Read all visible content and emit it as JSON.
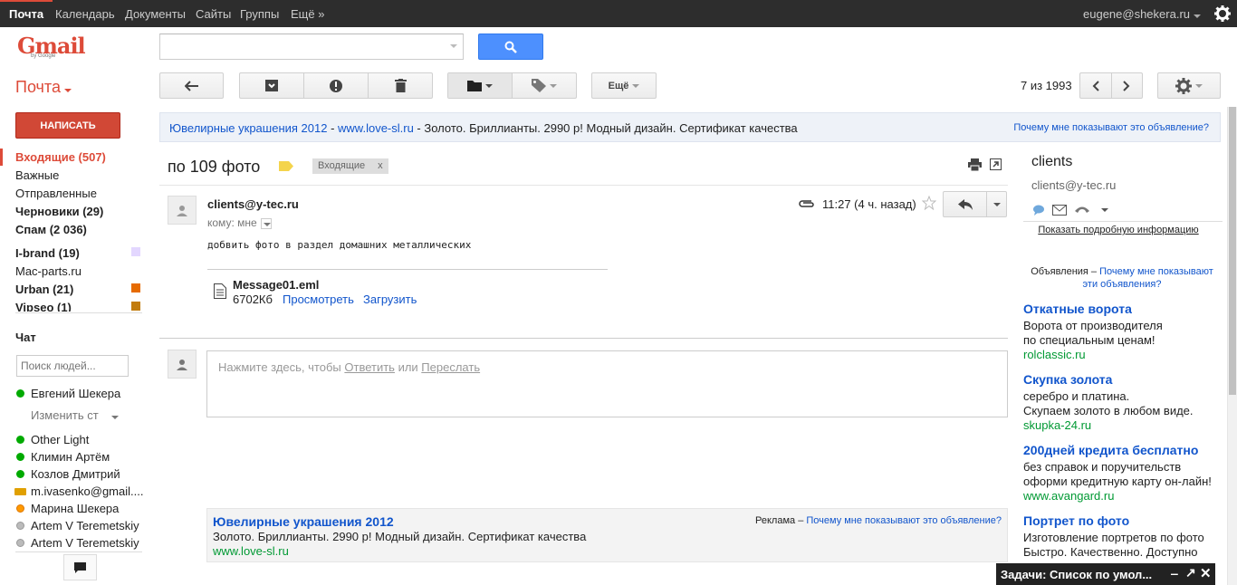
{
  "topbar": {
    "items": [
      "Почта",
      "Календарь",
      "Документы",
      "Сайты",
      "Группы",
      "Ещё »"
    ],
    "account": "eugene@shekera.ru"
  },
  "logo": {
    "text": "Gmail",
    "byline": "by Google"
  },
  "search": {
    "placeholder": "",
    "value": ""
  },
  "mail_label": "Почта",
  "toolbar": {
    "more": "Ещё",
    "pagination": "7 из 1993"
  },
  "compose": "НАПИСАТЬ",
  "folders": [
    {
      "label": "Входящие (507)",
      "bold": true,
      "active": true
    },
    {
      "label": "Важные"
    },
    {
      "label": "Отправленные"
    },
    {
      "label": "Черновики (29)",
      "bold": true
    },
    {
      "label": "Спам (2 036)",
      "bold": true
    },
    {
      "label": "I-brand (19)",
      "bold": true,
      "color": "#e3d7ff"
    },
    {
      "label": "Mac-parts.ru"
    },
    {
      "label": "Urban (21)",
      "bold": true,
      "color": "#e66b00"
    },
    {
      "label": "Vipseo (1)",
      "bold": true,
      "color": "#c27c0e"
    }
  ],
  "chat": {
    "title": "Чат",
    "search_placeholder": "Поиск людей...",
    "status": "Изменить ст",
    "contacts": [
      {
        "name": "Евгений Шекера",
        "status": "green"
      },
      {
        "name": "Other Light",
        "status": "green"
      },
      {
        "name": "Климин Артём",
        "status": "green"
      },
      {
        "name": "Козлов Дмитрий",
        "status": "green"
      },
      {
        "name": "m.ivasenko@gmail....",
        "status": "video"
      },
      {
        "name": "Марина Шекера",
        "status": "orange"
      },
      {
        "name": "Artem V Teremetskiy",
        "status": "gray"
      },
      {
        "name": "Artem V Teremetskiy",
        "status": "gray"
      }
    ]
  },
  "top_ad": {
    "title": "Ювелирные украшения 2012",
    "dash": " - ",
    "url": "www.love-sl.ru",
    "text": " - Золото. Бриллианты. 2990 р! Модный дизайн. Сертификат качества",
    "why": "Почему мне показывают это объявление?"
  },
  "thread": {
    "subject": "по 109 фото",
    "label": "Входящие",
    "label_x": "x"
  },
  "message": {
    "from": "clients@y-tec.ru",
    "to": "кому: мне",
    "time": "11:27 (4 ч. назад)",
    "body": "добвить фото в раздел домашних металлических",
    "attachment": {
      "name": "Message01.eml",
      "size": "6702Кб",
      "view": "Просмотреть",
      "download": "Загрузить"
    }
  },
  "reply": {
    "prefix": "Нажмите здесь, чтобы ",
    "reply_link": "Ответить",
    "middle": " или ",
    "forward_link": "Переслать"
  },
  "bottom_ad": {
    "title": "Ювелирные украшения 2012",
    "ad_label": "Реклама – ",
    "why": "Почему мне показывают это объявление?",
    "text": "Золото. Бриллианты. 2990 р! Модный дизайн. Сертификат качества",
    "url": "www.love-sl.ru"
  },
  "contact": {
    "name": "clients",
    "email": "clients@y-tec.ru",
    "details": "Показать подробную информацию"
  },
  "ads_header": {
    "label": "Объявления – ",
    "why_line1": "Почему мне показывают",
    "why_line2": "эти объявления?"
  },
  "side_ads": [
    {
      "title": "Откатные ворота",
      "lines": [
        "Ворота от производителя",
        "по специальным ценам!"
      ],
      "url": "rolclassic.ru"
    },
    {
      "title": "Скупка золота",
      "lines": [
        "серебро и платина.",
        "Скупаем золото в любом виде."
      ],
      "url": "skupka-24.ru"
    },
    {
      "title": "200дней кредита бесплатно",
      "lines": [
        "без справок и поручительств",
        "оформи кредитную карту он-лайн!"
      ],
      "url": "www.avangard.ru"
    },
    {
      "title": "Портрет по фото",
      "lines": [
        "Изготовление портретов по фото",
        "Быстро. Качественно. Доступно"
      ],
      "url": ""
    }
  ],
  "tasks": {
    "title": "Задачи: Список по умол..."
  }
}
